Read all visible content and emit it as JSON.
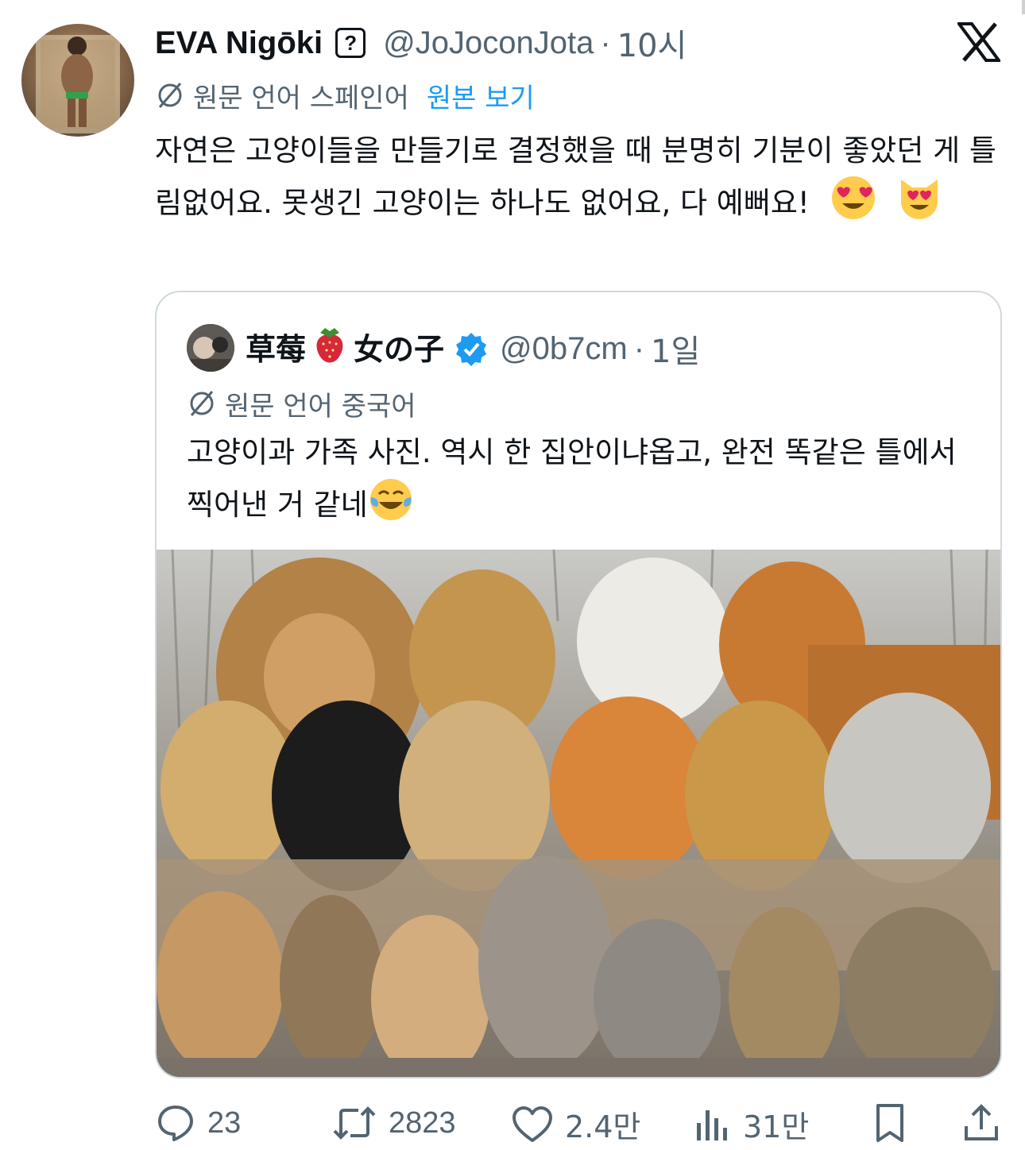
{
  "tweet": {
    "author_name": "EVA Nigōki",
    "unknown_badge": "?",
    "handle": "@JoJoconJota",
    "separator": "·",
    "time": "10시",
    "translation_note": "원문 언어 스페인어",
    "view_original": "원본 보기",
    "text": "자연은 고양이들을 만들기로 결정했을 때 분명히 기분이 좋았던 게 틀림없어요. 못생긴 고양이는 하나도 없어요, 다 예뻐요!",
    "emojis": [
      "smiling-face-with-heart-eyes",
      "smiling-cat-with-heart-eyes"
    ]
  },
  "quote": {
    "author_name_part1": "草莓",
    "author_name_part2": "女の子",
    "handle": "@0b7cm",
    "separator": "·",
    "time": "1일",
    "translation_note": "원문 언어 중국어",
    "text": "고양이과 가족 사진. 역시 한 집안이냐옵고, 완전 똑같은 틀에서 찍어낸 거 같네",
    "emoji": "face-with-tears-of-joy"
  },
  "actions": {
    "replies": "23",
    "retweets": "2823",
    "likes": "2.4만",
    "views": "31만"
  },
  "icons": {
    "logo": "x-logo-icon",
    "translate": "translate-icon",
    "verified": "verified-badge-icon",
    "reply": "reply-icon",
    "retweet": "retweet-icon",
    "like": "heart-icon",
    "views": "views-icon",
    "bookmark": "bookmark-icon",
    "share": "share-icon"
  },
  "colors": {
    "text": "#0f1419",
    "secondary": "#536471",
    "link": "#1d9bf0",
    "border": "#cfd9de",
    "verified": "#1d9bf0"
  }
}
